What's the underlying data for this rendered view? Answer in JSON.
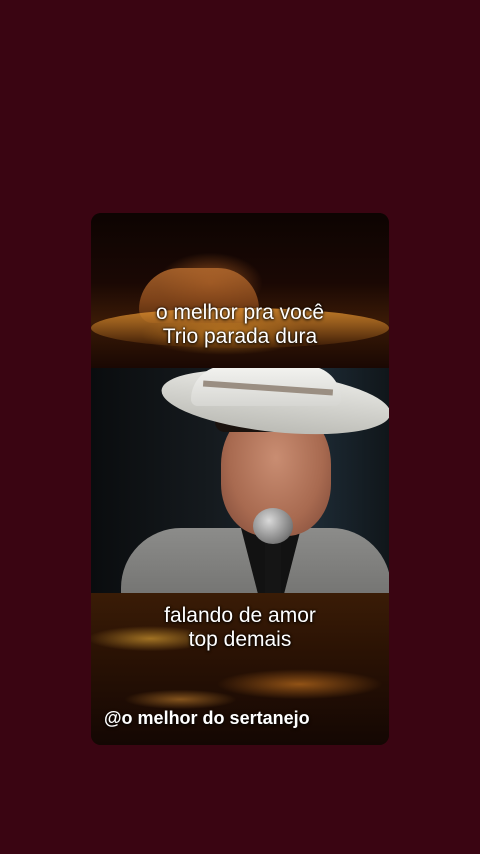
{
  "card": {
    "top_caption": {
      "line1": "o melhor pra você",
      "line2": "Trio parada dura"
    },
    "bottom_caption": {
      "line1": "falando de amor",
      "line2": "top demais"
    },
    "watermark": "@o melhor do sertanejo"
  },
  "colors": {
    "background": "#3a0512",
    "caption_text": "#ffffff"
  }
}
